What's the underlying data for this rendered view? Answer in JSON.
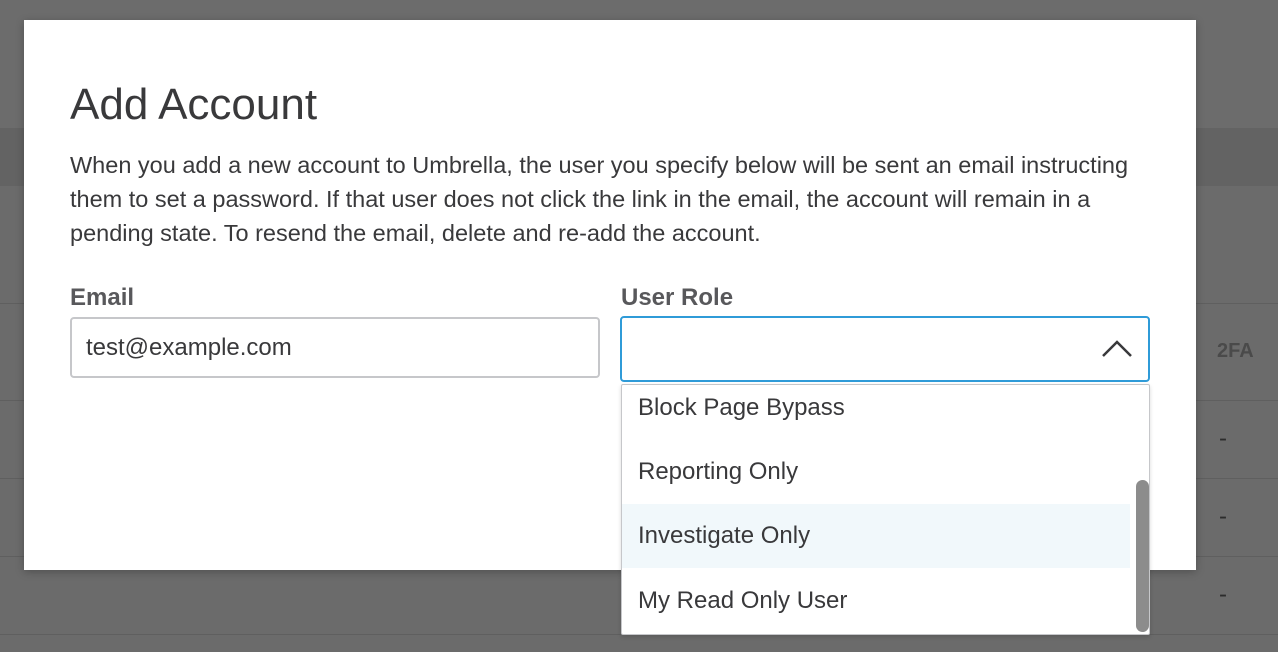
{
  "background": {
    "column_header_2fa": "2FA",
    "row_values": [
      "-",
      "-",
      "-"
    ]
  },
  "modal": {
    "title": "Add Account",
    "description": "When you add a new account to Umbrella, the user you specify below will be sent an email instructing them to set a password. If that user does not click the link in the email, the account will remain in a pending state. To resend the email, delete and re-add the account.",
    "email": {
      "label": "Email",
      "value": "test@example.com",
      "placeholder": ""
    },
    "user_role": {
      "label": "User Role",
      "selected_value": "",
      "icon": "chevron-up-icon",
      "options": [
        "Block Page Bypass",
        "Reporting Only",
        "Investigate Only",
        "My Read Only User"
      ],
      "highlighted_option": "Investigate Only"
    }
  },
  "colors": {
    "focus_border": "#2f9bd8",
    "highlight_bg": "#f1f8fb",
    "overlay": "#6b6b6b"
  }
}
